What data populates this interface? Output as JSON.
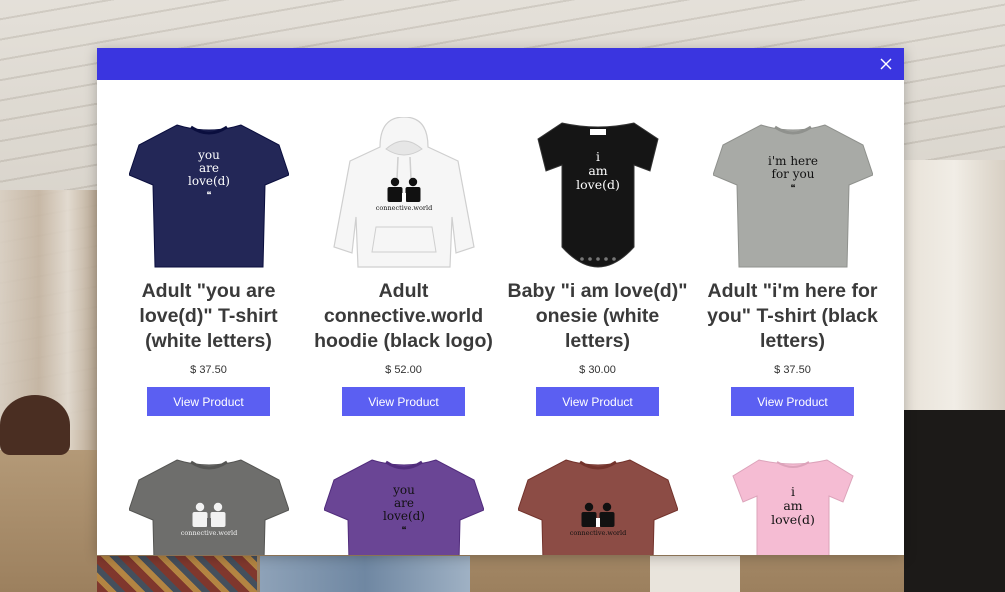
{
  "colors": {
    "modal_header": "#3a35e0",
    "button": "#5b5ff2",
    "navy": "#232757",
    "white_garment": "#f6f6f6",
    "black_garment": "#151515",
    "heather_gray": "#a8aaa6",
    "charcoal": "#6e6e6c",
    "purple": "#6a4595",
    "mauve": "#8c4c45",
    "pink": "#f5bcd3"
  },
  "modal": {
    "close_icon": "close-x-icon"
  },
  "products": [
    {
      "title": "Adult \"you are love(d)\" T-shirt (white letters)",
      "price": "$ 37.50",
      "button": "View Product",
      "garment": "tshirt",
      "color": "#232757",
      "print": [
        "you",
        "are",
        "love(d)",
        "❝"
      ],
      "print_color": "#ffffff"
    },
    {
      "title": "Adult connective.world hoodie (black logo)",
      "price": "$ 52.00",
      "button": "View Product",
      "garment": "hoodie",
      "color": "#f6f6f6",
      "print": [
        "connective.world"
      ],
      "print_color": "#111111"
    },
    {
      "title": "Baby \"i am love(d)\" onesie (white letters)",
      "price": "$ 30.00",
      "button": "View Product",
      "garment": "onesie",
      "color": "#151515",
      "print": [
        "i",
        "am",
        "love(d)"
      ],
      "print_color": "#ffffff"
    },
    {
      "title": "Adult \"i'm here for you\" T-shirt (black letters)",
      "price": "$ 37.50",
      "button": "View Product",
      "garment": "tshirt",
      "color": "#a8aaa6",
      "print": [
        "i'm here",
        "for you",
        "❝"
      ],
      "print_color": "#111111"
    },
    {
      "garment": "tshirt",
      "color": "#6e6e6c",
      "print": [
        "connective.world"
      ],
      "print_color": "#f2f2f2"
    },
    {
      "garment": "tshirt",
      "color": "#6a4595",
      "print": [
        "you",
        "are",
        "love(d)",
        "❝"
      ],
      "print_color": "#111111"
    },
    {
      "garment": "tshirt",
      "color": "#8c4c45",
      "print": [
        "connective.world"
      ],
      "print_color": "#111111"
    },
    {
      "garment": "onesie-short",
      "color": "#f5bcd3",
      "print": [
        "i",
        "am",
        "love(d)"
      ],
      "print_color": "#111111"
    }
  ]
}
